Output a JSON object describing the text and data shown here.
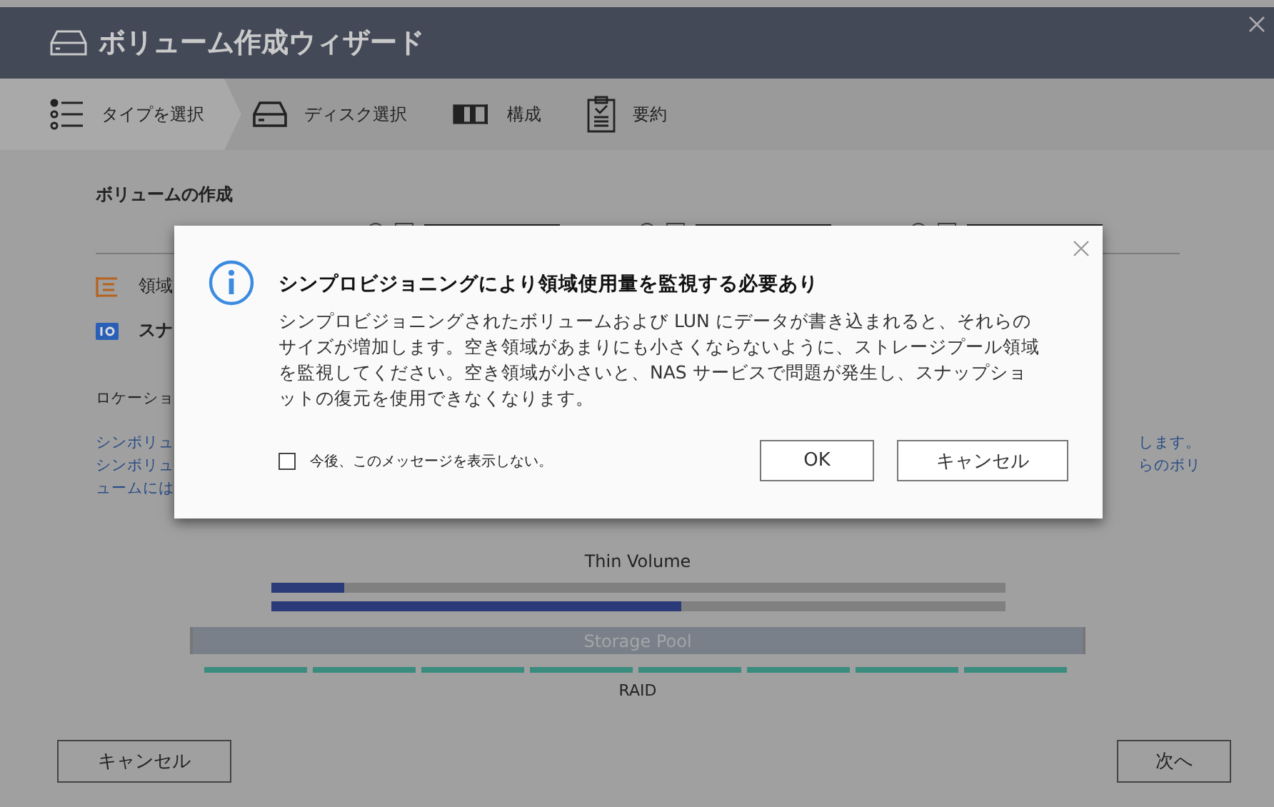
{
  "window": {
    "title": "ボリューム作成ウィザード"
  },
  "steps": [
    {
      "label": "タイプを選択",
      "selected": true,
      "kind": "list"
    },
    {
      "label": "ディスク選択",
      "selected": false,
      "kind": "disk"
    },
    {
      "label": "構成",
      "selected": false,
      "kind": "config"
    },
    {
      "label": "要約",
      "selected": false,
      "kind": "summary"
    }
  ],
  "section_title": "ボリュームの作成",
  "options": [
    {
      "label": "領域",
      "kind": "allocation"
    },
    {
      "label": "スナ",
      "kind": "snapshot"
    }
  ],
  "location_label": "ロケーショ",
  "description_left": [
    "シンボリュ",
    "シンボリュ",
    "ュームには"
  ],
  "description_right": [
    "します。",
    "らのボリ"
  ],
  "diagram": {
    "volume_label": "Thin Volume",
    "volumes": [
      {
        "level": 0.1
      },
      {
        "level": 0.56
      }
    ],
    "pool_label": "Storage Pool",
    "raid_label": "RAID"
  },
  "dialog": {
    "title": "シンプロビジョニングにより領域使用量を監視する必要あり",
    "message": "シンプロビジョニングされたボリュームおよび LUN にデータが書き込まれると、それらのサイズが増加します。空き領域があまりにも小さくならないように、ストレージプール領域を監視してください。空き領域が小さいと、NAS サービスで問題が発生し、スナップショットの復元を使用できなくなります。",
    "dont_show": {
      "label": "今後、このメッセージを表示しない。",
      "checked": false
    },
    "buttons": [
      "OK",
      "キャンセル"
    ]
  },
  "footer": {
    "buttons": [
      "キャンセル",
      "次へ"
    ]
  }
}
